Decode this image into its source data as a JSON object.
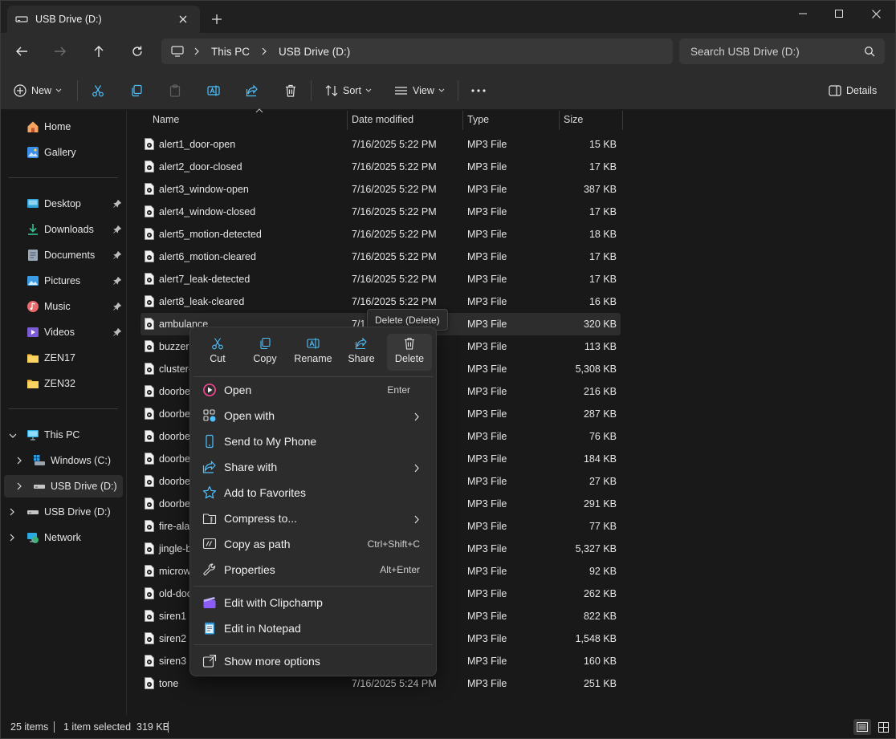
{
  "tab": {
    "title": "USB Drive (D:)"
  },
  "breadcrumb": [
    "This PC",
    "USB Drive (D:)"
  ],
  "search": {
    "placeholder": "Search USB Drive (D:)"
  },
  "toolbar": {
    "new_label": "New",
    "sort_label": "Sort",
    "view_label": "View",
    "details_label": "Details"
  },
  "sidebar": {
    "home": "Home",
    "gallery": "Gallery",
    "quick": [
      "Desktop",
      "Downloads",
      "Documents",
      "Pictures",
      "Music",
      "Videos",
      "ZEN17",
      "ZEN32"
    ],
    "this_pc": "This PC",
    "windows_c": "Windows (C:)",
    "usb_child": "USB Drive (D:)",
    "usb_root": "USB Drive (D:)",
    "network": "Network"
  },
  "columns": {
    "name": "Name",
    "date": "Date modified",
    "type": "Type",
    "size": "Size"
  },
  "files": [
    {
      "name": "alert1_door-open",
      "date": "7/16/2025 5:22 PM",
      "type": "MP3 File",
      "size": "15 KB"
    },
    {
      "name": "alert2_door-closed",
      "date": "7/16/2025 5:22 PM",
      "type": "MP3 File",
      "size": "17 KB"
    },
    {
      "name": "alert3_window-open",
      "date": "7/16/2025 5:22 PM",
      "type": "MP3 File",
      "size": "387 KB"
    },
    {
      "name": "alert4_window-closed",
      "date": "7/16/2025 5:22 PM",
      "type": "MP3 File",
      "size": "17 KB"
    },
    {
      "name": "alert5_motion-detected",
      "date": "7/16/2025 5:22 PM",
      "type": "MP3 File",
      "size": "18 KB"
    },
    {
      "name": "alert6_motion-cleared",
      "date": "7/16/2025 5:22 PM",
      "type": "MP3 File",
      "size": "17 KB"
    },
    {
      "name": "alert7_leak-detected",
      "date": "7/16/2025 5:22 PM",
      "type": "MP3 File",
      "size": "17 KB"
    },
    {
      "name": "alert8_leak-cleared",
      "date": "7/16/2025 5:22 PM",
      "type": "MP3 File",
      "size": "16 KB"
    },
    {
      "name": "ambulance",
      "date": "7/1",
      "type": "MP3 File",
      "size": "320 KB"
    },
    {
      "name": "buzzer-",
      "date": "",
      "type": "MP3 File",
      "size": "113 KB"
    },
    {
      "name": "cluster-",
      "date": "",
      "type": "MP3 File",
      "size": "5,308 KB"
    },
    {
      "name": "doorbe",
      "date": "",
      "type": "MP3 File",
      "size": "216 KB"
    },
    {
      "name": "doorbe",
      "date": "",
      "type": "MP3 File",
      "size": "287 KB"
    },
    {
      "name": "doorbe",
      "date": "",
      "type": "MP3 File",
      "size": "76 KB"
    },
    {
      "name": "doorbe",
      "date": "",
      "type": "MP3 File",
      "size": "184 KB"
    },
    {
      "name": "doorbe",
      "date": "",
      "type": "MP3 File",
      "size": "27 KB"
    },
    {
      "name": "doorbe",
      "date": "",
      "type": "MP3 File",
      "size": "291 KB"
    },
    {
      "name": "fire-ala",
      "date": "",
      "type": "MP3 File",
      "size": "77 KB"
    },
    {
      "name": "jingle-b",
      "date": "",
      "type": "MP3 File",
      "size": "5,327 KB"
    },
    {
      "name": "microw",
      "date": "",
      "type": "MP3 File",
      "size": "92 KB"
    },
    {
      "name": "old-doo",
      "date": "",
      "type": "MP3 File",
      "size": "262 KB"
    },
    {
      "name": "siren1",
      "date": "",
      "type": "MP3 File",
      "size": "822 KB"
    },
    {
      "name": "siren2",
      "date": "",
      "type": "MP3 File",
      "size": "1,548 KB"
    },
    {
      "name": "siren3",
      "date": "",
      "type": "MP3 File",
      "size": "160 KB"
    },
    {
      "name": "tone",
      "date": "7/16/2025 5:24 PM",
      "type": "MP3 File",
      "size": "251 KB"
    }
  ],
  "context_menu": {
    "quick_actions": [
      "Cut",
      "Copy",
      "Rename",
      "Share",
      "Delete"
    ],
    "items": [
      {
        "label": "Open",
        "shortcut": "Enter",
        "icon": "media-player-icon"
      },
      {
        "label": "Open with",
        "shortcut": "",
        "icon": "open-with-icon"
      },
      {
        "label": "Send to My Phone",
        "shortcut": "",
        "icon": "phone-icon"
      },
      {
        "label": "Share with",
        "shortcut": "",
        "icon": "share-icon"
      },
      {
        "label": "Add to Favorites",
        "shortcut": "",
        "icon": "star-icon"
      },
      {
        "label": "Compress to...",
        "shortcut": "",
        "icon": "zip-folder-icon"
      },
      {
        "label": "Copy as path",
        "shortcut": "Ctrl+Shift+C",
        "icon": "path-icon"
      },
      {
        "label": "Properties",
        "shortcut": "Alt+Enter",
        "icon": "wrench-icon"
      },
      {
        "label": "Edit with Clipchamp",
        "shortcut": "",
        "icon": "clipchamp-icon"
      },
      {
        "label": "Edit in Notepad",
        "shortcut": "",
        "icon": "notepad-icon"
      },
      {
        "label": "Show more options",
        "shortcut": "",
        "icon": "more-options-icon"
      }
    ]
  },
  "tooltip": "Delete (Delete)",
  "status": {
    "count": "25 items",
    "selection": "1 item selected  319 KB"
  },
  "colors": {
    "background": "#191919",
    "chrome": "#2c2c2c",
    "selection": "#2d2d2d",
    "accent": "#4cc2ff"
  }
}
